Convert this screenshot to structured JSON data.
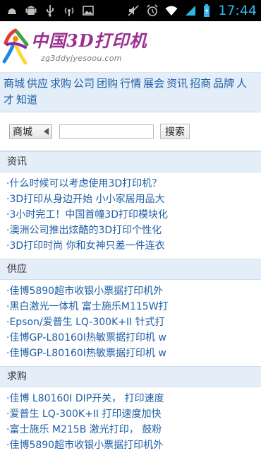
{
  "status_bar": {
    "time": "17:44",
    "icons": [
      "sd-card-icon",
      "android-icon",
      "usb-icon",
      "wireless-icon",
      "image-icon",
      "mute-icon",
      "alarm-icon",
      "wifi-icon",
      "signal-icon",
      "battery-icon"
    ]
  },
  "header": {
    "logo_title": "中国3D打印机",
    "logo_domain": "zg3ddyjyesoou.com"
  },
  "nav": {
    "items": [
      "商城",
      "供应",
      "求购",
      "公司",
      "团购",
      "行情",
      "展会",
      "资讯",
      "招商",
      "品牌",
      "人才",
      "知道"
    ]
  },
  "search": {
    "category_selected": "商城",
    "input_value": "",
    "button_label": "搜索"
  },
  "sections": [
    {
      "title": "资讯",
      "items": [
        "·什么时候可以考虑使用3D打印机？",
        "·3D打印从身边开始 小小家居用品大",
        "·3小时完工！中国首幢3D打印模块化",
        "·澳洲公司推出炫酷的3D打印个性化",
        "·3D打印时尚 你和女神只差一件连衣"
      ]
    },
    {
      "title": "供应",
      "items": [
        "·佳博5890超市收银小票据打印机外",
        "·黑白激光一体机 富士施乐M115W打",
        "·Epson/爱普生 LQ-300K+II 针式打",
        "·佳博GP-L80160I热敏票据打印机 w",
        "·佳博GP-L80160I热敏票据打印机 w"
      ]
    },
    {
      "title": "求购",
      "items": [
        "·佳博 L80160I DIP开关， 打印速度",
        "·爱普生 LQ-300K+II 打印速度加快",
        "·富士施乐 M215B 激光打印， 鼓粉",
        "·佳博5890超市收银小票据打印机外"
      ]
    }
  ]
}
